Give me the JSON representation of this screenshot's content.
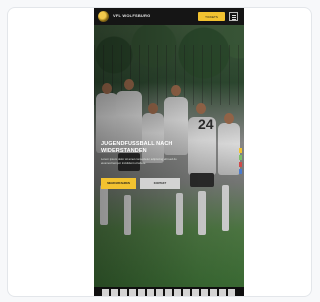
{
  "header": {
    "brand": "VFL WOLFSBURG",
    "cta_label": "TICKETS",
    "menu_icon": "hamburger-menu-icon"
  },
  "hero": {
    "headline": "JUGENDFUSSBALL NACH WIDERSTANDEN",
    "subtext": "Lorem ipsum dolor sit amet consectetur adipiscing elit sed do eiusmod tempor incididunt ut labore.",
    "primary_button": "MEHR ERFAHREN",
    "secondary_button": "KONTAKT",
    "jersey_number": "24"
  },
  "colors": {
    "accent": "#f2c230",
    "nav_bg": "#151515"
  },
  "side_indicators": [
    "#f2c230",
    "#7bbf6a",
    "#d04a4a",
    "#4a7bd0"
  ]
}
